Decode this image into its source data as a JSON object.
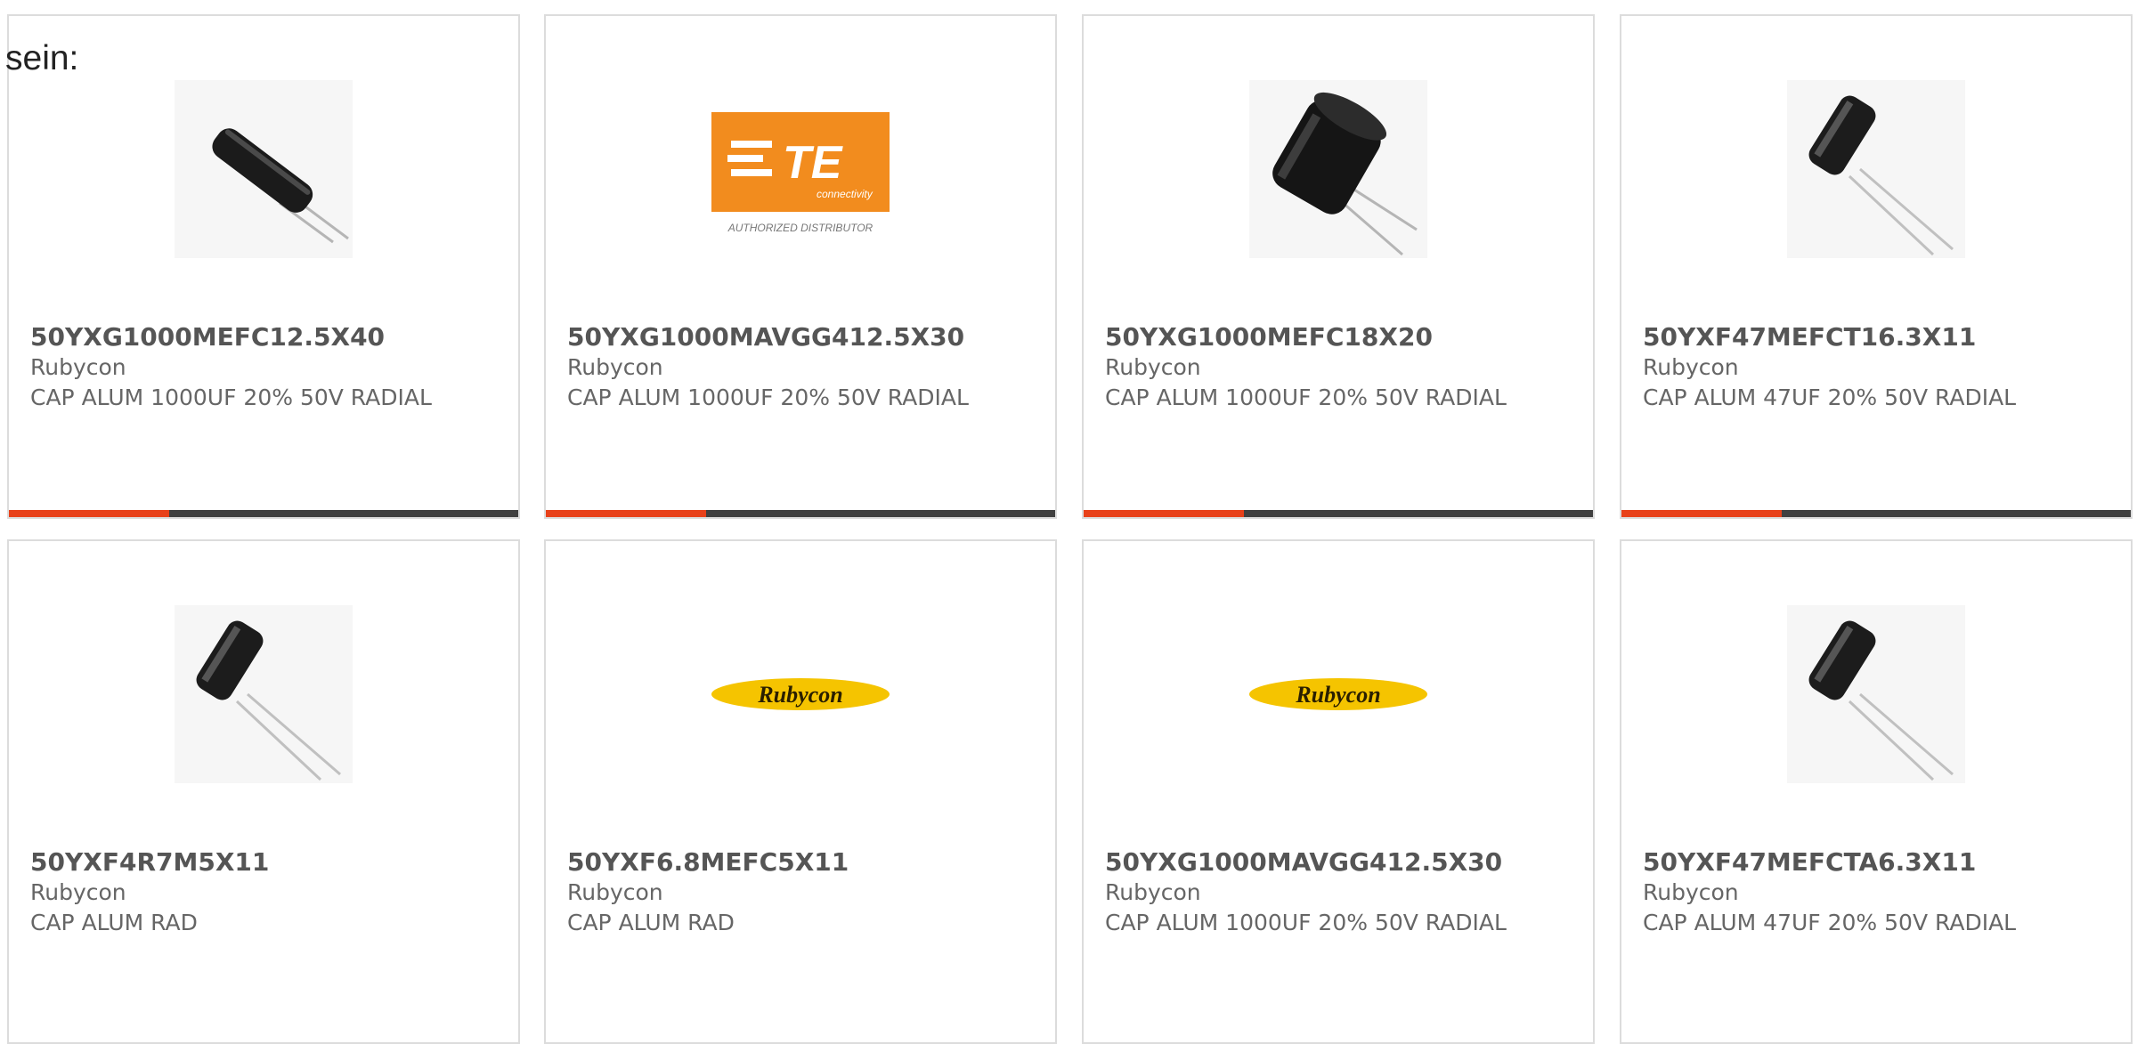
{
  "prefix_text": "sein:",
  "products": [
    {
      "part_number": "50YXG1000MEFC12.5X40",
      "manufacturer": "Rubycon",
      "description": "CAP ALUM 1000UF 20% 50V RADIAL",
      "image": "capacitor-long-icon"
    },
    {
      "part_number": "50YXG1000MAVGG412.5X30",
      "manufacturer": "Rubycon",
      "description": "CAP ALUM 1000UF 20% 50V RADIAL",
      "image": "te-connectivity-logo",
      "logo": {
        "brand_text": "TE",
        "sub_text": "connectivity",
        "tagline": "AUTHORIZED DISTRIBUTOR",
        "color": "#f28c1e"
      }
    },
    {
      "part_number": "50YXG1000MEFC18X20",
      "manufacturer": "Rubycon",
      "description": "CAP ALUM 1000UF 20% 50V RADIAL",
      "image": "capacitor-wide-icon"
    },
    {
      "part_number": "50YXF47MEFCT16.3X11",
      "manufacturer": "Rubycon",
      "description": "CAP ALUM 47UF 20% 50V RADIAL",
      "image": "capacitor-small-icon"
    },
    {
      "part_number": "50YXF4R7M5X11",
      "manufacturer": "Rubycon",
      "description": "CAP ALUM RAD",
      "image": "capacitor-small-icon"
    },
    {
      "part_number": "50YXF6.8MEFC5X11",
      "manufacturer": "Rubycon",
      "description": "CAP ALUM RAD",
      "image": "rubycon-logo",
      "logo": {
        "brand_text": "Rubycon",
        "color": "#f5c400"
      }
    },
    {
      "part_number": "50YXG1000MAVGG412.5X30",
      "manufacturer": "Rubycon",
      "description": "CAP ALUM 1000UF 20% 50V RADIAL",
      "image": "rubycon-logo",
      "logo": {
        "brand_text": "Rubycon",
        "color": "#f5c400"
      }
    },
    {
      "part_number": "50YXF47MEFCTA6.3X11",
      "manufacturer": "Rubycon",
      "description": "CAP ALUM 47UF 20% 50V RADIAL",
      "image": "capacitor-small-icon"
    }
  ],
  "colors": {
    "accent": "#e8411a",
    "bar_dark": "#404040",
    "border": "#dcdcdc"
  }
}
